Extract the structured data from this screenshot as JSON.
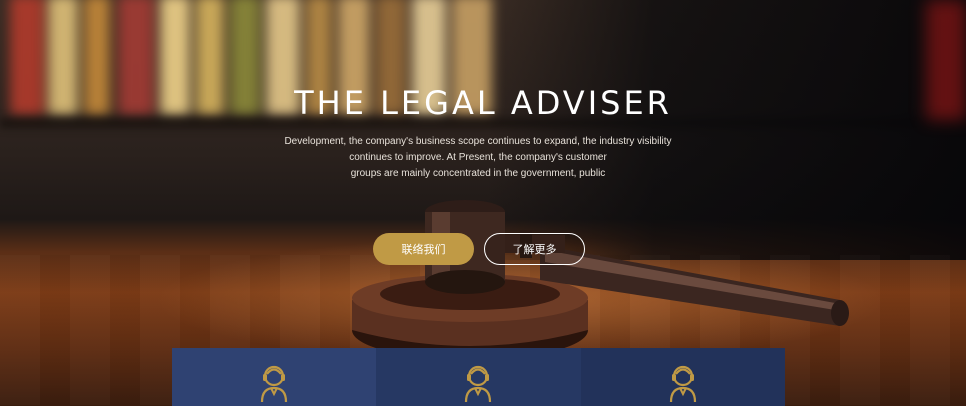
{
  "hero": {
    "title": "THE LEGAL ADVISER",
    "description_lines": [
      "Development, the company's business scope continues to expand, the industry visibility",
      "continues to improve. At Present, the company's customer",
      "groups are mainly concentrated in the government, public"
    ],
    "primary_button": "联络我们",
    "secondary_button": "了解更多"
  },
  "colors": {
    "accent_gold": "#c09a45",
    "feature_blue_1": "#2f4272",
    "feature_blue_2": "#263863",
    "feature_blue_3": "#22325a"
  },
  "features": [
    {
      "icon": "lawyer-icon"
    },
    {
      "icon": "lawyer-icon"
    },
    {
      "icon": "lawyer-icon"
    }
  ]
}
